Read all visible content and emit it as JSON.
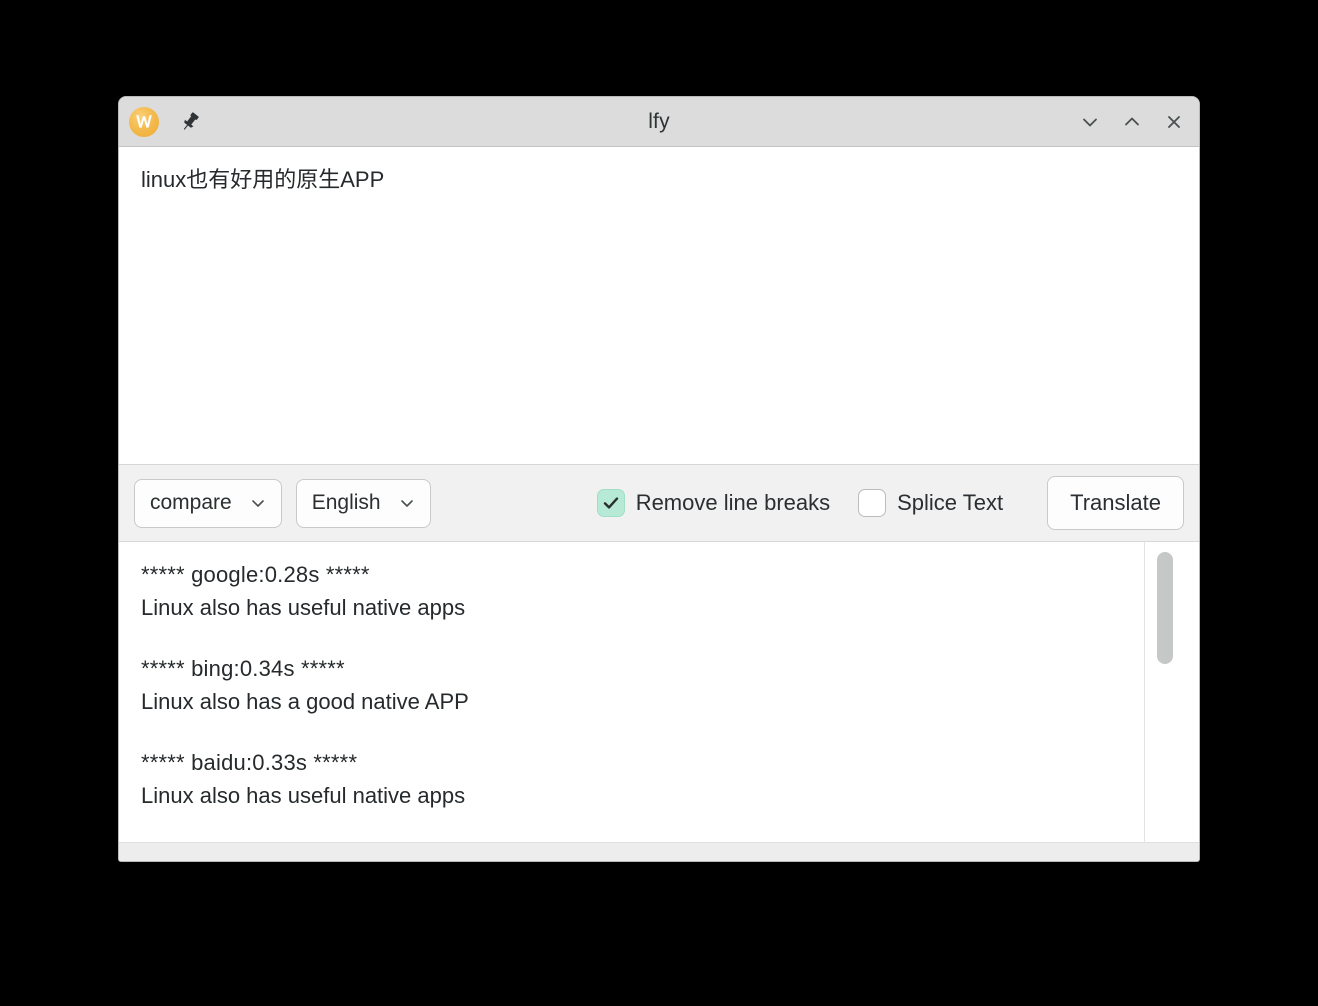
{
  "window": {
    "title": "lfy",
    "app_icon": "w-logo-icon",
    "pin_icon": "pushpin-icon",
    "controls": [
      {
        "name": "minimize-button",
        "icon": "chevron-down-icon"
      },
      {
        "name": "maximize-button",
        "icon": "chevron-up-icon"
      },
      {
        "name": "close-button",
        "icon": "close-icon"
      }
    ]
  },
  "input": {
    "text": "linux也有好用的原生APP",
    "placeholder": ""
  },
  "toolbar": {
    "engine_select": {
      "value": "compare",
      "icon": "chevron-down-icon"
    },
    "language_select": {
      "value": "English",
      "icon": "chevron-down-icon"
    },
    "remove_line_breaks": {
      "label": "Remove line breaks",
      "checked": true
    },
    "splice_text": {
      "label": "Splice Text",
      "checked": false
    },
    "translate_label": "Translate"
  },
  "output": {
    "results": [
      {
        "header": "***** google:0.28s *****",
        "text": "Linux also has useful native apps"
      },
      {
        "header": "***** bing:0.34s *****",
        "text": "Linux also has a good native APP"
      },
      {
        "header": "***** baidu:0.33s *****",
        "text": "Linux also has useful native apps"
      }
    ]
  },
  "colors": {
    "checkbox_checked_fill": "#b6ead7",
    "titlebar": "#dcdcdc",
    "toolbar": "#f1f1f1",
    "app_icon": "#f2b544",
    "desktop": "#000000"
  }
}
